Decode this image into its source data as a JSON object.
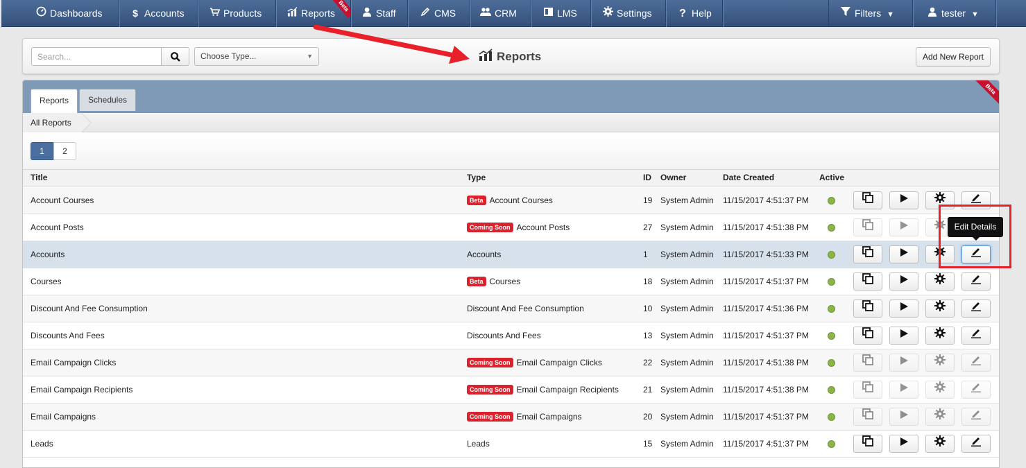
{
  "nav": {
    "items": [
      {
        "label": "Dashboards",
        "icon": "dashboard-icon"
      },
      {
        "label": "Accounts",
        "icon": "dollar-icon"
      },
      {
        "label": "Products",
        "icon": "cart-icon"
      },
      {
        "label": "Reports",
        "icon": "chart-icon",
        "badge": "Beta"
      },
      {
        "label": "Staff",
        "icon": "person-icon"
      },
      {
        "label": "CMS",
        "icon": "pencil-icon"
      },
      {
        "label": "CRM",
        "icon": "people-icon"
      },
      {
        "label": "LMS",
        "icon": "book-icon"
      },
      {
        "label": "Settings",
        "icon": "gear-icon"
      },
      {
        "label": "Help",
        "icon": "question-icon"
      }
    ],
    "filters_label": "Filters",
    "user_label": "tester"
  },
  "header": {
    "search_placeholder": "Search...",
    "type_select_value": "Choose Type...",
    "title": "Reports",
    "add_button_label": "Add New Report"
  },
  "tabs": {
    "reports_label": "Reports",
    "schedules_label": "Schedules",
    "corner_badge": "Beta"
  },
  "breadcrumb": {
    "current": "All Reports"
  },
  "pagination": {
    "pages": [
      "1",
      "2"
    ],
    "current": "1"
  },
  "table": {
    "columns": [
      "Title",
      "Type",
      "ID",
      "Owner",
      "Date Created",
      "Active"
    ],
    "rows": [
      {
        "title": "Account Courses",
        "tag": "Beta",
        "type": "Account Courses",
        "id": "19",
        "owner": "System Admin",
        "date": "11/15/2017 4:51:37 PM",
        "enabled": true
      },
      {
        "title": "Account Posts",
        "tag": "Coming Soon",
        "type": "Account Posts",
        "id": "27",
        "owner": "System Admin",
        "date": "11/15/2017 4:51:38 PM",
        "enabled": false
      },
      {
        "title": "Accounts",
        "tag": "",
        "type": "Accounts",
        "id": "1",
        "owner": "System Admin",
        "date": "11/15/2017 4:51:33 PM",
        "enabled": true
      },
      {
        "title": "Courses",
        "tag": "Beta",
        "type": "Courses",
        "id": "18",
        "owner": "System Admin",
        "date": "11/15/2017 4:51:37 PM",
        "enabled": true
      },
      {
        "title": "Discount And Fee Consumption",
        "tag": "",
        "type": "Discount And Fee Consumption",
        "id": "10",
        "owner": "System Admin",
        "date": "11/15/2017 4:51:36 PM",
        "enabled": true
      },
      {
        "title": "Discounts And Fees",
        "tag": "",
        "type": "Discounts And Fees",
        "id": "13",
        "owner": "System Admin",
        "date": "11/15/2017 4:51:37 PM",
        "enabled": true
      },
      {
        "title": "Email Campaign Clicks",
        "tag": "Coming Soon",
        "type": "Email Campaign Clicks",
        "id": "22",
        "owner": "System Admin",
        "date": "11/15/2017 4:51:38 PM",
        "enabled": false
      },
      {
        "title": "Email Campaign Recipients",
        "tag": "Coming Soon",
        "type": "Email Campaign Recipients",
        "id": "21",
        "owner": "System Admin",
        "date": "11/15/2017 4:51:38 PM",
        "enabled": false
      },
      {
        "title": "Email Campaigns",
        "tag": "Coming Soon",
        "type": "Email Campaigns",
        "id": "20",
        "owner": "System Admin",
        "date": "11/15/2017 4:51:37 PM",
        "enabled": false
      },
      {
        "title": "Leads",
        "tag": "",
        "type": "Leads",
        "id": "15",
        "owner": "System Admin",
        "date": "11/15/2017 4:51:37 PM",
        "enabled": true
      }
    ]
  },
  "tooltip": {
    "text": "Edit Details"
  },
  "colors": {
    "nav_bg": "#3f5f8a",
    "tab_bar": "#7f9ab7",
    "active_dot": "#8cb548",
    "tag_red": "#d9242f",
    "annotation_red": "#e8202a"
  }
}
